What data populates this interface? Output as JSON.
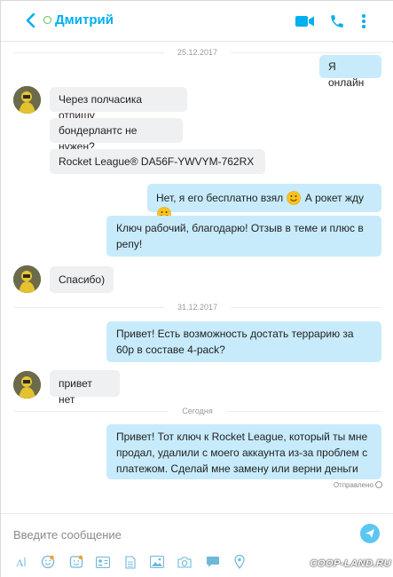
{
  "header": {
    "contact_name": "Дмитрий",
    "accent": "#00aff0",
    "icons": [
      "back-arrow-icon",
      "presence-icon",
      "video-call-icon",
      "phone-icon",
      "more-icon"
    ]
  },
  "messages": {
    "date_1": "25.12.2017",
    "m1": "Я онлайн",
    "m2": "Через полчасика отпишу",
    "m3": "бондерлантс не нужен?",
    "m4": "Rocket League®  DA56F-YWVYM-762RX",
    "m5a": "Нет, я его бесплатно взял",
    "m5b": "А рокет жду",
    "m6": "Ключ рабочий, благодарю! Отзыв в теме и плюс в репу!",
    "m7": "Спасибо)",
    "date_2": "31.12.2017",
    "m8": "Привет! Есть возможность достать террарию за 60р в составе 4-pack?",
    "m9": "привет нет",
    "date_3": "Сегодня",
    "m10": "Привет! Тот ключ к Rocket League, который ты мне продал, удалили с моего аккаунта из-за проблем с платежом. Сделай мне замену или верни деньги",
    "status": "Отправлено"
  },
  "composer": {
    "placeholder": "Введите сообщение",
    "toolbar_icons": [
      "text-format-icon",
      "emoticon-icon",
      "mojis-icon",
      "contact-card-icon",
      "file-icon",
      "media-icon",
      "camera-icon",
      "chat-bubble-icon",
      "location-icon"
    ]
  },
  "watermark": "COOP-LAND.RU",
  "colors": {
    "outgoing": "#c7ebfb",
    "incoming": "#eef0f2"
  }
}
